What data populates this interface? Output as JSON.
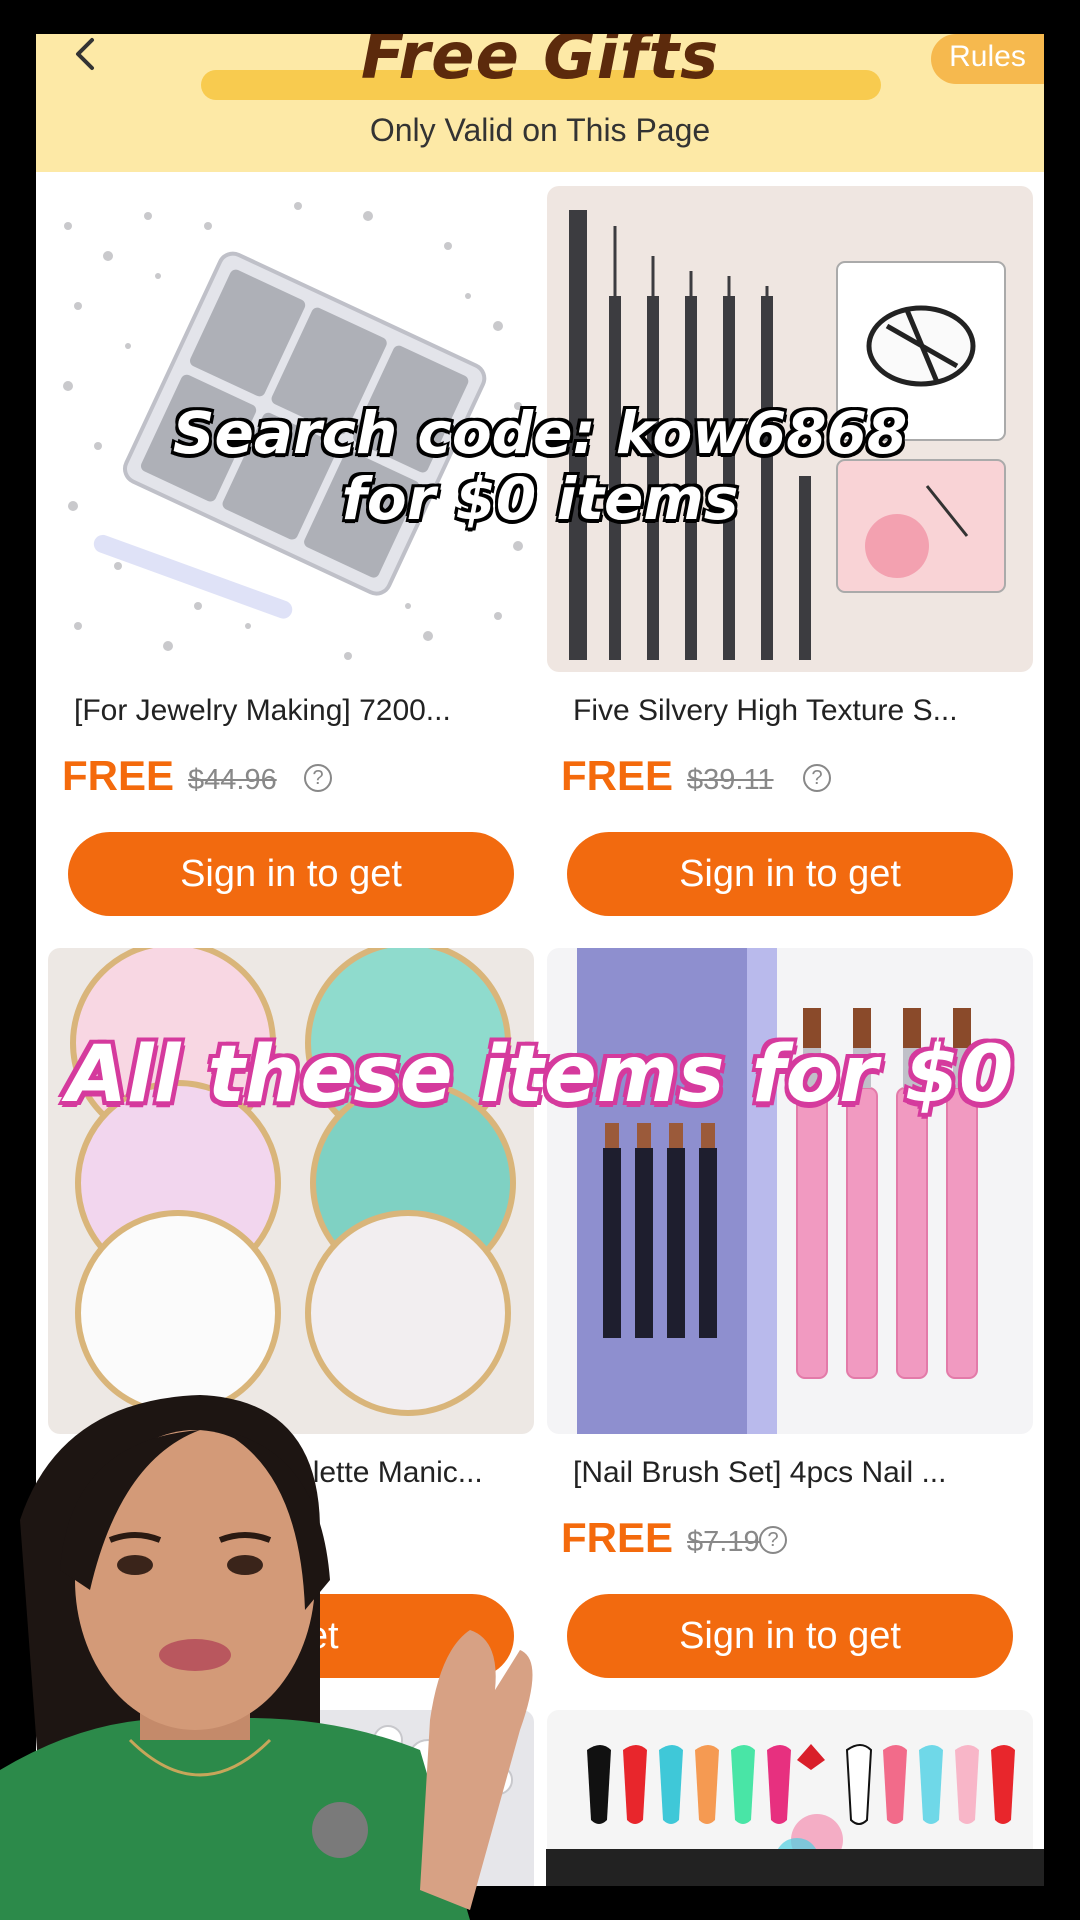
{
  "header": {
    "title": "Free Gifts",
    "subtitle": "Only Valid on This Page",
    "rules_label": "Rules",
    "back_icon": "chevron-left-icon"
  },
  "products": [
    {
      "name": "[For Jewelry Making] 7200...",
      "free_label": "FREE",
      "original_price": "$44.96",
      "cta": "Sign in to get"
    },
    {
      "name": "Five Silvery High Texture S...",
      "free_label": "FREE",
      "original_price": "$39.11",
      "cta": "Sign in to get"
    },
    {
      "name": "Palette Manic...",
      "free_label": "",
      "original_price": "",
      "cta": "to get"
    },
    {
      "name": "[Nail Brush Set] 4pcs Nail ...",
      "free_label": "FREE",
      "original_price": "$7.19",
      "cta": "Sign in to get"
    }
  ],
  "help_glyph": "?",
  "captions": {
    "line1": "Search code: kow6868",
    "line2": "for $0 items",
    "main": "All these items for $0"
  },
  "colors": {
    "accent_orange": "#f26a0f",
    "header_bg": "#fde9a6",
    "caption_pink": "#d53a9d"
  }
}
